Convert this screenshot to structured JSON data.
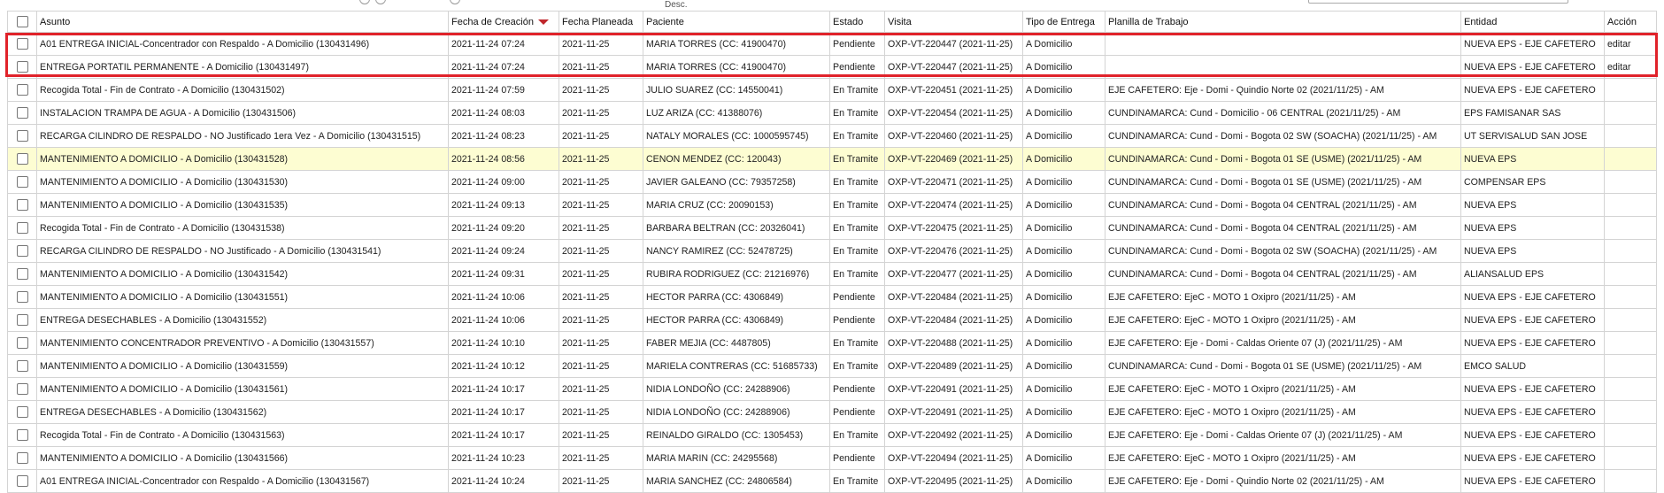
{
  "top": {
    "desc_label": "Desc."
  },
  "columns": [
    "Asunto",
    "Fecha de Creación",
    "Fecha Planeada",
    "Paciente",
    "Estado",
    "Visita",
    "Tipo de Entrega",
    "Planilla de Trabajo",
    "Entidad",
    "Acción"
  ],
  "rows": [
    [
      "A01 ENTREGA INICIAL-Concentrador con Respaldo - A Domicilio (130431496)",
      "2021-11-24 07:24",
      "2021-11-25",
      "MARIA TORRES (CC: 41900470)",
      "Pendiente",
      "OXP-VT-220447 (2021-11-25)",
      "A Domicilio",
      "",
      "NUEVA EPS - EJE CAFETERO",
      "editar"
    ],
    [
      "ENTREGA PORTATIL PERMANENTE - A Domicilio (130431497)",
      "2021-11-24 07:24",
      "2021-11-25",
      "MARIA TORRES (CC: 41900470)",
      "Pendiente",
      "OXP-VT-220447 (2021-11-25)",
      "A Domicilio",
      "",
      "NUEVA EPS - EJE CAFETERO",
      "editar"
    ],
    [
      "Recogida Total - Fin de Contrato - A Domicilio (130431502)",
      "2021-11-24 07:59",
      "2021-11-25",
      "JULIO SUAREZ (CC: 14550041)",
      "En Tramite",
      "OXP-VT-220451 (2021-11-25)",
      "A Domicilio",
      "EJE CAFETERO: Eje - Domi - Quindio Norte 02 (2021/11/25) - AM",
      "NUEVA EPS - EJE CAFETERO",
      ""
    ],
    [
      "INSTALACION TRAMPA DE AGUA - A Domicilio (130431506)",
      "2021-11-24 08:03",
      "2021-11-25",
      "LUZ ARIZA (CC: 41388076)",
      "En Tramite",
      "OXP-VT-220454 (2021-11-25)",
      "A Domicilio",
      "CUNDINAMARCA: Cund - Domicilio - 06 CENTRAL (2021/11/25) - AM",
      "EPS FAMISANAR SAS",
      ""
    ],
    [
      "RECARGA CILINDRO DE RESPALDO - NO Justificado 1era Vez - A Domicilio (130431515)",
      "2021-11-24 08:23",
      "2021-11-25",
      "NATALY MORALES (CC: 1000595745)",
      "En Tramite",
      "OXP-VT-220460 (2021-11-25)",
      "A Domicilio",
      "CUNDINAMARCA: Cund - Domi - Bogota 02 SW (SOACHA) (2021/11/25) - AM",
      "UT SERVISALUD SAN JOSE",
      ""
    ],
    [
      "MANTENIMIENTO A DOMICILIO - A Domicilio (130431528)",
      "2021-11-24 08:56",
      "2021-11-25",
      "CENON MENDEZ (CC: 120043)",
      "En Tramite",
      "OXP-VT-220469 (2021-11-25)",
      "A Domicilio",
      "CUNDINAMARCA: Cund - Domi - Bogota 01 SE (USME) (2021/11/25) - AM",
      "NUEVA EPS",
      ""
    ],
    [
      "MANTENIMIENTO A DOMICILIO - A Domicilio (130431530)",
      "2021-11-24 09:00",
      "2021-11-25",
      "JAVIER GALEANO (CC: 79357258)",
      "En Tramite",
      "OXP-VT-220471 (2021-11-25)",
      "A Domicilio",
      "CUNDINAMARCA: Cund - Domi - Bogota 01 SE (USME) (2021/11/25) - AM",
      "COMPENSAR EPS",
      ""
    ],
    [
      "MANTENIMIENTO A DOMICILIO - A Domicilio (130431535)",
      "2021-11-24 09:13",
      "2021-11-25",
      "MARIA CRUZ (CC: 20090153)",
      "En Tramite",
      "OXP-VT-220474 (2021-11-25)",
      "A Domicilio",
      "CUNDINAMARCA: Cund - Domi - Bogota 04 CENTRAL (2021/11/25) - AM",
      "NUEVA EPS",
      ""
    ],
    [
      "Recogida Total - Fin de Contrato - A Domicilio (130431538)",
      "2021-11-24 09:20",
      "2021-11-25",
      "BARBARA BELTRAN (CC: 20326041)",
      "En Tramite",
      "OXP-VT-220475 (2021-11-25)",
      "A Domicilio",
      "CUNDINAMARCA: Cund - Domi - Bogota 04 CENTRAL (2021/11/25) - AM",
      "NUEVA EPS",
      ""
    ],
    [
      "RECARGA CILINDRO DE RESPALDO - NO Justificado - A Domicilio (130431541)",
      "2021-11-24 09:24",
      "2021-11-25",
      "NANCY RAMIREZ (CC: 52478725)",
      "En Tramite",
      "OXP-VT-220476 (2021-11-25)",
      "A Domicilio",
      "CUNDINAMARCA: Cund - Domi - Bogota 02 SW (SOACHA) (2021/11/25) - AM",
      "NUEVA EPS",
      ""
    ],
    [
      "MANTENIMIENTO A DOMICILIO - A Domicilio (130431542)",
      "2021-11-24 09:31",
      "2021-11-25",
      "RUBIRA RODRIGUEZ (CC: 21216976)",
      "En Tramite",
      "OXP-VT-220477 (2021-11-25)",
      "A Domicilio",
      "CUNDINAMARCA: Cund - Domi - Bogota 04 CENTRAL (2021/11/25) - AM",
      "ALIANSALUD EPS",
      ""
    ],
    [
      "MANTENIMIENTO A DOMICILIO - A Domicilio (130431551)",
      "2021-11-24 10:06",
      "2021-11-25",
      "HECTOR PARRA (CC: 4306849)",
      "Pendiente",
      "OXP-VT-220484 (2021-11-25)",
      "A Domicilio",
      "EJE CAFETERO: EjeC - MOTO 1 Oxipro (2021/11/25) - AM",
      "NUEVA EPS - EJE CAFETERO",
      ""
    ],
    [
      "ENTREGA DESECHABLES - A Domicilio (130431552)",
      "2021-11-24 10:06",
      "2021-11-25",
      "HECTOR PARRA (CC: 4306849)",
      "Pendiente",
      "OXP-VT-220484 (2021-11-25)",
      "A Domicilio",
      "EJE CAFETERO: EjeC - MOTO 1 Oxipro (2021/11/25) - AM",
      "NUEVA EPS - EJE CAFETERO",
      ""
    ],
    [
      "MANTENIMIENTO CONCENTRADOR PREVENTIVO - A Domicilio (130431557)",
      "2021-11-24 10:10",
      "2021-11-25",
      "FABER MEJIA (CC: 4487805)",
      "En Tramite",
      "OXP-VT-220488 (2021-11-25)",
      "A Domicilio",
      "EJE CAFETERO: Eje - Domi - Caldas Oriente 07 (J) (2021/11/25) - AM",
      "NUEVA EPS - EJE CAFETERO",
      ""
    ],
    [
      "MANTENIMIENTO A DOMICILIO - A Domicilio (130431559)",
      "2021-11-24 10:12",
      "2021-11-25",
      "MARIELA CONTRERAS (CC: 51685733)",
      "En Tramite",
      "OXP-VT-220489 (2021-11-25)",
      "A Domicilio",
      "CUNDINAMARCA: Cund - Domi - Bogota 01 SE (USME) (2021/11/25) - AM",
      "EMCO SALUD",
      ""
    ],
    [
      "MANTENIMIENTO A DOMICILIO - A Domicilio (130431561)",
      "2021-11-24 10:17",
      "2021-11-25",
      "NIDIA LONDOÑO (CC: 24288906)",
      "Pendiente",
      "OXP-VT-220491 (2021-11-25)",
      "A Domicilio",
      "EJE CAFETERO: EjeC - MOTO 1 Oxipro (2021/11/25) - AM",
      "NUEVA EPS - EJE CAFETERO",
      ""
    ],
    [
      "ENTREGA DESECHABLES - A Domicilio (130431562)",
      "2021-11-24 10:17",
      "2021-11-25",
      "NIDIA LONDOÑO (CC: 24288906)",
      "Pendiente",
      "OXP-VT-220491 (2021-11-25)",
      "A Domicilio",
      "EJE CAFETERO: EjeC - MOTO 1 Oxipro (2021/11/25) - AM",
      "NUEVA EPS - EJE CAFETERO",
      ""
    ],
    [
      "Recogida Total - Fin de Contrato - A Domicilio (130431563)",
      "2021-11-24 10:17",
      "2021-11-25",
      "REINALDO GIRALDO (CC: 1305453)",
      "En Tramite",
      "OXP-VT-220492 (2021-11-25)",
      "A Domicilio",
      "EJE CAFETERO: Eje - Domi - Caldas Oriente 07 (J) (2021/11/25) - AM",
      "NUEVA EPS - EJE CAFETERO",
      ""
    ],
    [
      "MANTENIMIENTO A DOMICILIO - A Domicilio (130431566)",
      "2021-11-24 10:23",
      "2021-11-25",
      "MARIA MARIN (CC: 24295568)",
      "Pendiente",
      "OXP-VT-220494 (2021-11-25)",
      "A Domicilio",
      "EJE CAFETERO: EjeC - MOTO 1 Oxipro (2021/11/25) - AM",
      "NUEVA EPS - EJE CAFETERO",
      ""
    ],
    [
      "A01 ENTREGA INICIAL-Concentrador con Respaldo - A Domicilio (130431567)",
      "2021-11-24 10:24",
      "2021-11-25",
      "MARIA SANCHEZ (CC: 24806584)",
      "En Tramite",
      "OXP-VT-220495 (2021-11-25)",
      "A Domicilio",
      "EJE CAFETERO: Eje - Domi - Quindio Norte 02 (2021/11/25) - AM",
      "NUEVA EPS - EJE CAFETERO",
      ""
    ]
  ],
  "highlighted_row": 5,
  "colors": {
    "highlight": "#fdfdd2",
    "selection_box": "#e0222a",
    "sort_arrow": "#c0282d"
  }
}
